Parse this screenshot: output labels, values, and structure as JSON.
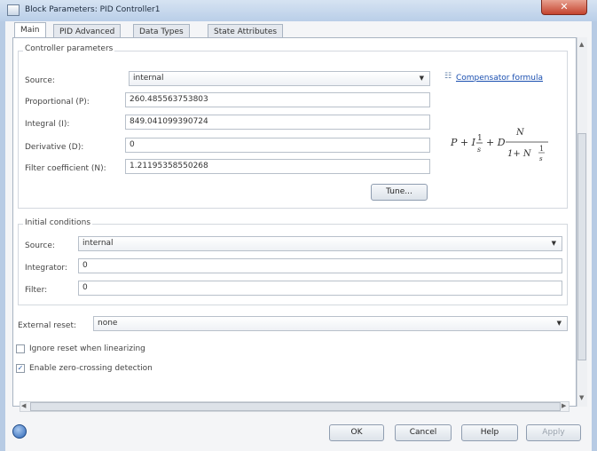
{
  "window": {
    "title": "Block Parameters: PID Controller1",
    "close_glyph": "✕"
  },
  "tabs": [
    {
      "label": "Main",
      "active": true
    },
    {
      "label": "PID Advanced"
    },
    {
      "label": "Data Types"
    },
    {
      "label": "State Attributes"
    }
  ],
  "controller": {
    "section_title": "Controller parameters",
    "source_label": "Source:",
    "source_value": "internal",
    "compensator_link": "Compensator formula",
    "proportional_label": "Proportional (P):",
    "proportional_value": "260.485563753803",
    "integral_label": "Integral (I):",
    "integral_value": "849.041099390724",
    "derivative_label": "Derivative (D):",
    "derivative_value": "0",
    "filter_label": "Filter coefficient (N):",
    "filter_value": "1.21195358550268",
    "tune_button": "Tune..."
  },
  "initial_conditions": {
    "section_title": "Initial conditions",
    "source_label": "Source:",
    "source_value": "internal",
    "integrator_label": "Integrator:",
    "integrator_value": "0",
    "filter_label": "Filter:",
    "filter_value": "0"
  },
  "external_reset": {
    "label": "External reset:",
    "value": "none"
  },
  "checkboxes": {
    "ignore_reset": {
      "label": "Ignore reset when linearizing",
      "checked": false
    },
    "zero_crossing": {
      "label": "Enable zero-crossing detection",
      "checked": true
    }
  },
  "buttons": {
    "ok": "OK",
    "cancel": "Cancel",
    "help": "Help",
    "apply": "Apply"
  },
  "icons": {
    "dropdown": "▼",
    "scroll_up": "▲",
    "scroll_down": "▼",
    "scroll_left": "◀",
    "scroll_right": "▶",
    "link_icon": "☷",
    "checkmark": "✓"
  },
  "colors": {
    "accent": "#2a64b5",
    "link": "#1a4fb0",
    "close": "#c4432e"
  }
}
